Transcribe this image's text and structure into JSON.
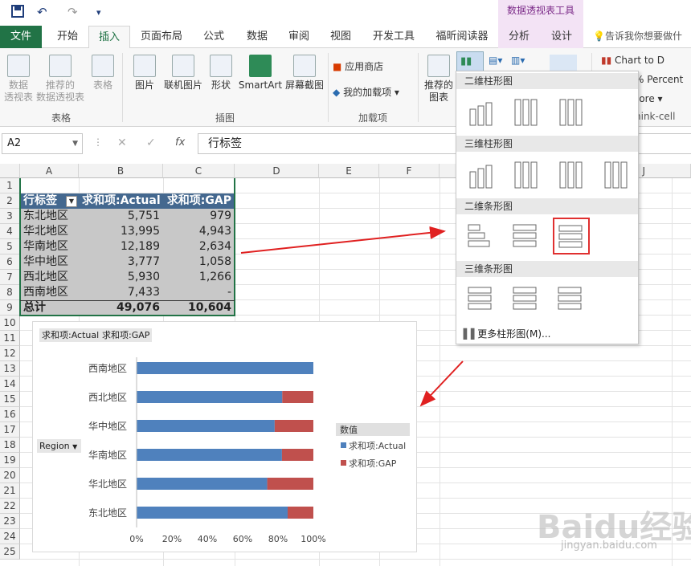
{
  "qat": {
    "save_icon": "save-icon",
    "undo_icon": "undo-icon",
    "redo_icon": "redo-icon",
    "customize_icon": "customize-icon"
  },
  "context_title": "数据透视表工具",
  "tabs": [
    {
      "label": "文件"
    },
    {
      "label": "开始"
    },
    {
      "label": "插入"
    },
    {
      "label": "页面布局"
    },
    {
      "label": "公式"
    },
    {
      "label": "数据"
    },
    {
      "label": "审阅"
    },
    {
      "label": "视图"
    },
    {
      "label": "开发工具"
    },
    {
      "label": "福昕阅读器"
    },
    {
      "label": "分析"
    },
    {
      "label": "设计"
    }
  ],
  "tellme": "告诉我你想要做什么",
  "ribbon": {
    "pivot": {
      "l1": "数据",
      "l2": "透视表"
    },
    "rec_pivot": {
      "l1": "推荐的",
      "l2": "数据透视表"
    },
    "table": "表格",
    "group_tables": "表格",
    "picture": "图片",
    "online_picture": "联机图片",
    "shapes": "形状",
    "smartart": "SmartArt",
    "screenshot": "屏幕截图",
    "group_illustrations": "插图",
    "store": "应用商店",
    "my_addins": "我的加载项",
    "group_addins": "加载项",
    "rec_charts": {
      "l1": "推荐的",
      "l2": "图表"
    },
    "chart_to": "Chart to D",
    "percent": "% Percent",
    "more": "lore",
    "thinkcell": "hink-cell"
  },
  "formula_bar": {
    "name_box": "A2",
    "fx": "fx",
    "content": "行标签"
  },
  "columns": [
    "A",
    "B",
    "C",
    "D",
    "E",
    "F",
    "J"
  ],
  "rows": [
    "1",
    "2",
    "3",
    "4",
    "5",
    "6",
    "7",
    "8",
    "9",
    "10",
    "11",
    "12",
    "13",
    "14",
    "15",
    "16",
    "17",
    "18",
    "19",
    "20",
    "21",
    "22",
    "23",
    "24",
    "25"
  ],
  "pivot": {
    "headers": [
      "行标签",
      "求和项:Actual",
      "求和项:GAP"
    ],
    "rows": [
      {
        "region": "东北地区",
        "actual": "5,751",
        "gap": "979"
      },
      {
        "region": "华北地区",
        "actual": "13,995",
        "gap": "4,943"
      },
      {
        "region": "华南地区",
        "actual": "12,189",
        "gap": "2,634"
      },
      {
        "region": "华中地区",
        "actual": "3,777",
        "gap": "1,058"
      },
      {
        "region": "西北地区",
        "actual": "5,930",
        "gap": "1,266"
      },
      {
        "region": "西南地区",
        "actual": "7,433",
        "gap": "-"
      }
    ],
    "total": {
      "label": "总计",
      "actual": "49,076",
      "gap": "10,604"
    }
  },
  "chart_field_buttons": {
    "actual": "求和项:Actual",
    "gap": "求和项:GAP",
    "region": "Region"
  },
  "chart_data": {
    "type": "bar",
    "stacked": "percent",
    "categories": [
      "西南地区",
      "西北地区",
      "华中地区",
      "华南地区",
      "华北地区",
      "东北地区"
    ],
    "series": [
      {
        "name": "求和项:Actual",
        "values": [
          7433,
          5930,
          3777,
          12189,
          13995,
          5751
        ],
        "color": "#4f81bd"
      },
      {
        "name": "求和项:GAP",
        "values": [
          0,
          1266,
          1058,
          2634,
          4943,
          979
        ],
        "color": "#c0504d"
      }
    ],
    "x_ticks": [
      "0%",
      "20%",
      "40%",
      "60%",
      "80%",
      "100%"
    ],
    "xlim": [
      0,
      100
    ],
    "legend_title": "数值",
    "legend_position": "right",
    "grid": false
  },
  "dropdown": {
    "sections": [
      "二维柱形图",
      "三维柱形图",
      "二维条形图",
      "三维条形图"
    ],
    "more": "更多柱形图(M)...",
    "selected": "100%堆积条形图"
  },
  "watermark": "Baidu经验",
  "watermark_url": "jingyan.baidu.com"
}
